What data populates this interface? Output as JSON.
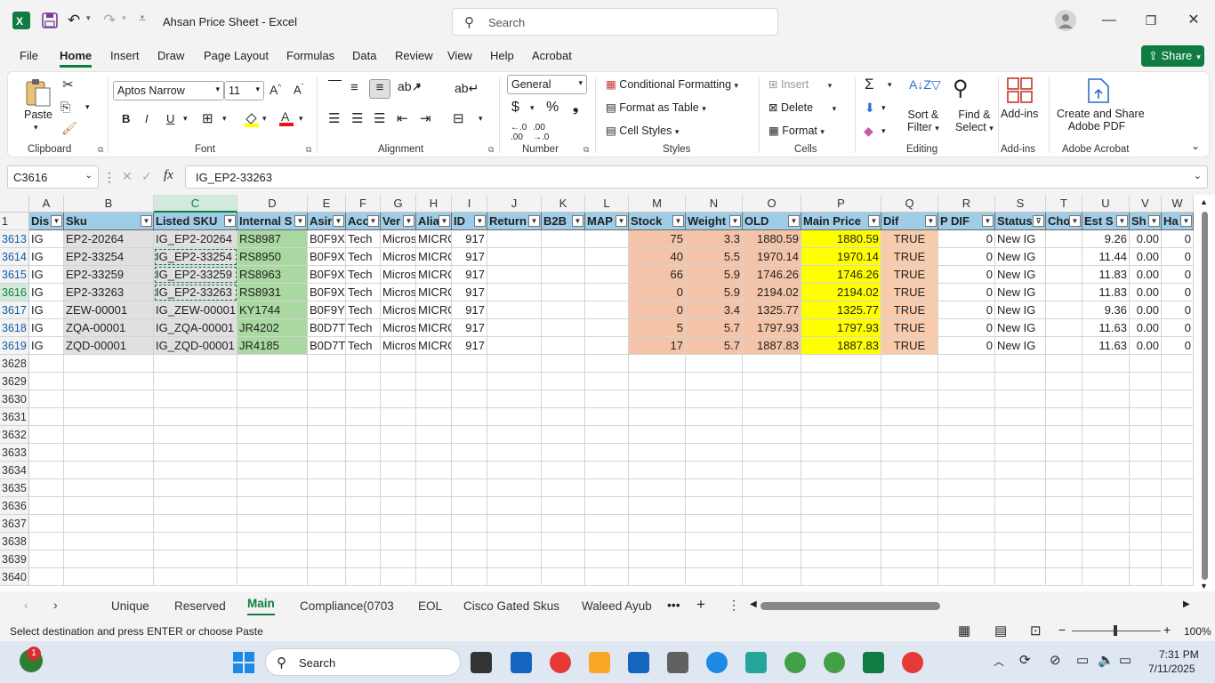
{
  "app": {
    "title": "Ahsan Price Sheet  -  Excel",
    "search_placeholder": "Search",
    "share_label": "Share"
  },
  "menu": [
    "File",
    "Home",
    "Insert",
    "Draw",
    "Page Layout",
    "Formulas",
    "Data",
    "Review",
    "View",
    "Help",
    "Acrobat"
  ],
  "ribbon": {
    "clipboard": {
      "label": "Clipboard",
      "paste": "Paste"
    },
    "font": {
      "label": "Font",
      "name": "Aptos Narrow",
      "size": "11"
    },
    "alignment": {
      "label": "Alignment"
    },
    "number": {
      "label": "Number",
      "format": "General"
    },
    "styles": {
      "label": "Styles",
      "conditional": "Conditional Formatting",
      "table": "Format as Table",
      "cell_styles": "Cell Styles"
    },
    "cells": {
      "label": "Cells",
      "insert": "Insert",
      "delete": "Delete",
      "format": "Format"
    },
    "editing": {
      "label": "Editing",
      "sort1": "Sort &",
      "sort2": "Filter",
      "find1": "Find &",
      "find2": "Select"
    },
    "addins": {
      "label": "Add-ins",
      "btn": "Add-ins"
    },
    "acrobat": {
      "label": "Adobe Acrobat",
      "btn1": "Create and Share",
      "btn2": "Adobe PDF"
    }
  },
  "formula_bar": {
    "name_box": "C3616",
    "fx": "fx",
    "content": "IG_EP2-33263"
  },
  "columns": [
    "A",
    "B",
    "C",
    "D",
    "E",
    "F",
    "G",
    "H",
    "I",
    "J",
    "K",
    "L",
    "M",
    "N",
    "O",
    "P",
    "Q",
    "R",
    "S",
    "T",
    "U",
    "V",
    "W"
  ],
  "header_row_num": "1",
  "headers": [
    "Dis",
    "Sku",
    "Listed SKU",
    "Internal S",
    "Asir",
    "Acc",
    "Ver",
    "Alia",
    "ID",
    "Return",
    "B2B",
    "MAP",
    "Stock",
    "Weight",
    "OLD",
    "Main Price",
    "Dif",
    "P DIF",
    "Status",
    "Cho",
    "Est S",
    "Sh",
    "Ha"
  ],
  "rows": [
    {
      "num": "3613",
      "cells": [
        "IG",
        "EP2-20264",
        "IG_EP2-20264",
        "RS8987",
        "B0F9XF",
        "Tech",
        "Micros",
        "MICRO",
        "917",
        "",
        "",
        "",
        "75",
        "3.3",
        "1880.59",
        "1880.59",
        "TRUE",
        "0",
        "New IG",
        "",
        "9.26",
        "0.00",
        "0"
      ]
    },
    {
      "num": "3614",
      "cells": [
        "IG",
        "EP2-33254",
        "IG_EP2-33254",
        "RS8950",
        "B0F9X0",
        "Tech",
        "Micros",
        "MICRO",
        "917",
        "",
        "",
        "",
        "40",
        "5.5",
        "1970.14",
        "1970.14",
        "TRUE",
        "0",
        "New IG",
        "",
        "11.44",
        "0.00",
        "0"
      ]
    },
    {
      "num": "3615",
      "cells": [
        "IG",
        "EP2-33259",
        "IG_EP2-33259",
        "RS8963",
        "B0F9XE",
        "Tech",
        "Micros",
        "MICRO",
        "917",
        "",
        "",
        "",
        "66",
        "5.9",
        "1746.26",
        "1746.26",
        "TRUE",
        "0",
        "New IG",
        "",
        "11.83",
        "0.00",
        "0"
      ]
    },
    {
      "num": "3616",
      "cells": [
        "IG",
        "EP2-33263",
        "IG_EP2-33263",
        "RS8931",
        "B0F9XD",
        "Tech",
        "Micros",
        "MICRO",
        "917",
        "",
        "",
        "",
        "0",
        "5.9",
        "2194.02",
        "2194.02",
        "TRUE",
        "0",
        "New IG",
        "",
        "11.83",
        "0.00",
        "0"
      ]
    },
    {
      "num": "3617",
      "cells": [
        "IG",
        "ZEW-00001",
        "IG_ZEW-00001",
        "KY1744",
        "B0F9Y1",
        "Tech",
        "Micros",
        "MICRO",
        "917",
        "",
        "",
        "",
        "0",
        "3.4",
        "1325.77",
        "1325.77",
        "TRUE",
        "0",
        "New IG",
        "",
        "9.36",
        "0.00",
        "0"
      ]
    },
    {
      "num": "3618",
      "cells": [
        "IG",
        "ZQA-00001",
        "IG_ZQA-00001",
        "JR4202",
        "B0D7TI",
        "Tech",
        "Micros",
        "MICRO",
        "917",
        "",
        "",
        "",
        "5",
        "5.7",
        "1797.93",
        "1797.93",
        "TRUE",
        "0",
        "New IG",
        "",
        "11.63",
        "0.00",
        "0"
      ]
    },
    {
      "num": "3619",
      "cells": [
        "IG",
        "ZQD-00001",
        "IG_ZQD-00001",
        "JR4185",
        "B0D7T0",
        "Tech",
        "Micros",
        "MICRO",
        "917",
        "",
        "",
        "",
        "17",
        "5.7",
        "1887.83",
        "1887.83",
        "TRUE",
        "0",
        "New IG",
        "",
        "11.63",
        "0.00",
        "0"
      ]
    }
  ],
  "empty_rows": [
    "3628",
    "3629",
    "3630",
    "3631",
    "3632",
    "3633",
    "3634",
    "3635",
    "3636",
    "3637",
    "3638",
    "3639",
    "3640"
  ],
  "sheet_tabs": [
    "Unique",
    "Reserved",
    "Main",
    "Compliance(0703",
    "EOL",
    "Cisco Gated Skus",
    "Waleed Ayub"
  ],
  "active_tab": "Main",
  "status": {
    "message": "Select destination and press ENTER or choose Paste",
    "zoom": "100%"
  },
  "taskbar": {
    "search": "Search",
    "time": "7:31 PM",
    "date": "7/11/2025",
    "badge": "1"
  },
  "colors": {
    "excel_green": "#107c41",
    "header_blue": "#9fcde8",
    "sku_gray": "#e0e0e0",
    "internal_green": "#a9d8a0",
    "stock_salmon": "#f4c4a8",
    "price_yellow": "#ffff00",
    "dif_salmon": "#f8cbad"
  }
}
